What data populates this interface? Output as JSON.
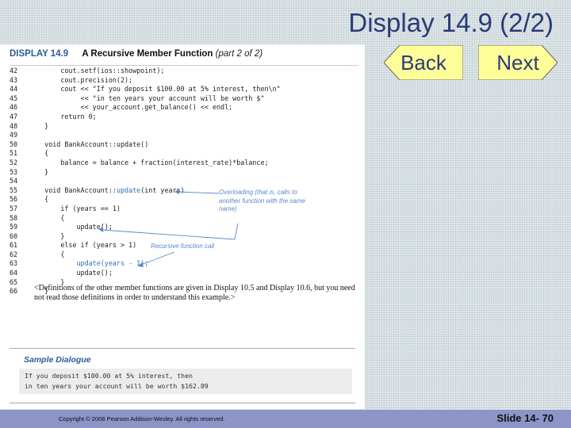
{
  "slide_title": "Display 14.9 (2/2)",
  "display_header": {
    "label": "DISPLAY 14.9",
    "function_title": "A Recursive Member Function",
    "part": "(part 2 of 2)"
  },
  "code_lines": [
    {
      "num": "42",
      "text": "        cout.setf(ios::showpoint);"
    },
    {
      "num": "43",
      "text": "        cout.precision(2);"
    },
    {
      "num": "44",
      "text": "        cout << \"If you deposit $100.00 at 5% interest, then\\n\""
    },
    {
      "num": "45",
      "text": "             << \"in ten years your account will be worth $\""
    },
    {
      "num": "46",
      "text": "             << your_account.get_balance() << endl;"
    },
    {
      "num": "47",
      "text": "        return 0;"
    },
    {
      "num": "48",
      "text": "    }"
    },
    {
      "num": "49",
      "text": ""
    },
    {
      "num": "50",
      "text": "    void BankAccount::update()"
    },
    {
      "num": "51",
      "text": "    {"
    },
    {
      "num": "52",
      "text": "        balance = balance + fraction(interest_rate)*balance;"
    },
    {
      "num": "53",
      "text": "    }"
    },
    {
      "num": "54",
      "text": ""
    },
    {
      "num": "55",
      "pre": "    void BankAccount::",
      "hl": "update",
      "post": "(int years)"
    },
    {
      "num": "56",
      "text": "    {"
    },
    {
      "num": "57",
      "text": "        if (years == 1)"
    },
    {
      "num": "58",
      "text": "        {"
    },
    {
      "num": "59",
      "text": "            update();"
    },
    {
      "num": "60",
      "text": "        }"
    },
    {
      "num": "61",
      "text": "        else if (years > 1)"
    },
    {
      "num": "62",
      "text": "        {"
    },
    {
      "num": "63",
      "pre": "            ",
      "hl": "update(years - 1);",
      "post": ""
    },
    {
      "num": "64",
      "text": "            update();"
    },
    {
      "num": "65",
      "text": "        }"
    },
    {
      "num": "66",
      "text": "    }"
    }
  ],
  "annotations": {
    "overloading": "Overloading (that is, calls to another function with the same name)",
    "recursive": "Recursive function call"
  },
  "note_text": "<Definitions of the other member functions are given in Display 10.5 and Display 10.6, but you need not read those definitions in order to understand this example.>",
  "sample": {
    "title": "Sample Dialogue",
    "lines": [
      "If you deposit $100.00 at 5% interest, then",
      "in ten years your account will be worth $162.89"
    ]
  },
  "nav": {
    "back_label": "Back",
    "next_label": "Next"
  },
  "footer": {
    "copyright": "Copyright © 2008 Pearson Addison-Wesley.  All rights reserved.",
    "slide_number": "Slide 14- 70"
  },
  "colors": {
    "title": "#2a3b78",
    "footer_bar": "#8c94c8",
    "button_fill": "#ffff99",
    "highlight_code": "#2d6fb6",
    "annotation": "#5a87c6"
  }
}
